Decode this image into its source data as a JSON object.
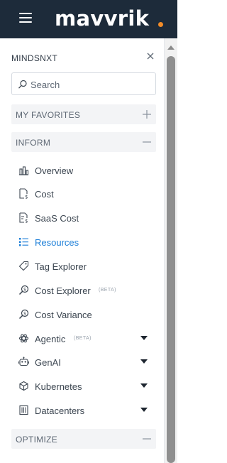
{
  "brand": {
    "logo_text": "mavvrik",
    "accent": "#f28c28"
  },
  "panel": {
    "org_name": "MINDSNXT",
    "search": {
      "placeholder": "Search",
      "value": ""
    },
    "sections": [
      {
        "label": "MY FAVORITES",
        "state": "collapsed",
        "toggle_icon": "plus-icon"
      },
      {
        "label": "INFORM",
        "state": "expanded",
        "toggle_icon": "minus-icon"
      },
      {
        "label": "OPTIMIZE",
        "state": "expanded",
        "toggle_icon": "minus-icon"
      }
    ],
    "inform_items": [
      {
        "label": "Overview",
        "icon": "bar-chart-icon"
      },
      {
        "label": "Cost",
        "icon": "cost-sheet-icon"
      },
      {
        "label": "SaaS Cost",
        "icon": "saas-cost-icon"
      },
      {
        "label": "Resources",
        "icon": "resources-list-icon",
        "active": true
      },
      {
        "label": "Tag Explorer",
        "icon": "tag-icon"
      },
      {
        "label": "Cost Explorer",
        "icon": "cost-explorer-icon",
        "badge": "(BETA)"
      },
      {
        "label": "Cost Variance",
        "icon": "cost-variance-icon"
      },
      {
        "label": "Agentic",
        "icon": "agentic-icon",
        "badge": "(BETA)",
        "has_submenu": true
      },
      {
        "label": "GenAI",
        "icon": "robot-icon",
        "has_submenu": true
      },
      {
        "label": "Kubernetes",
        "icon": "cube-icon",
        "has_submenu": true
      },
      {
        "label": "Datacenters",
        "icon": "datacenter-icon",
        "has_submenu": true
      }
    ]
  },
  "colors": {
    "topbar_bg": "#1d2b3a",
    "active": "#1d7fd8",
    "section_bg": "#f3f4f6",
    "text": "#3c4651"
  }
}
